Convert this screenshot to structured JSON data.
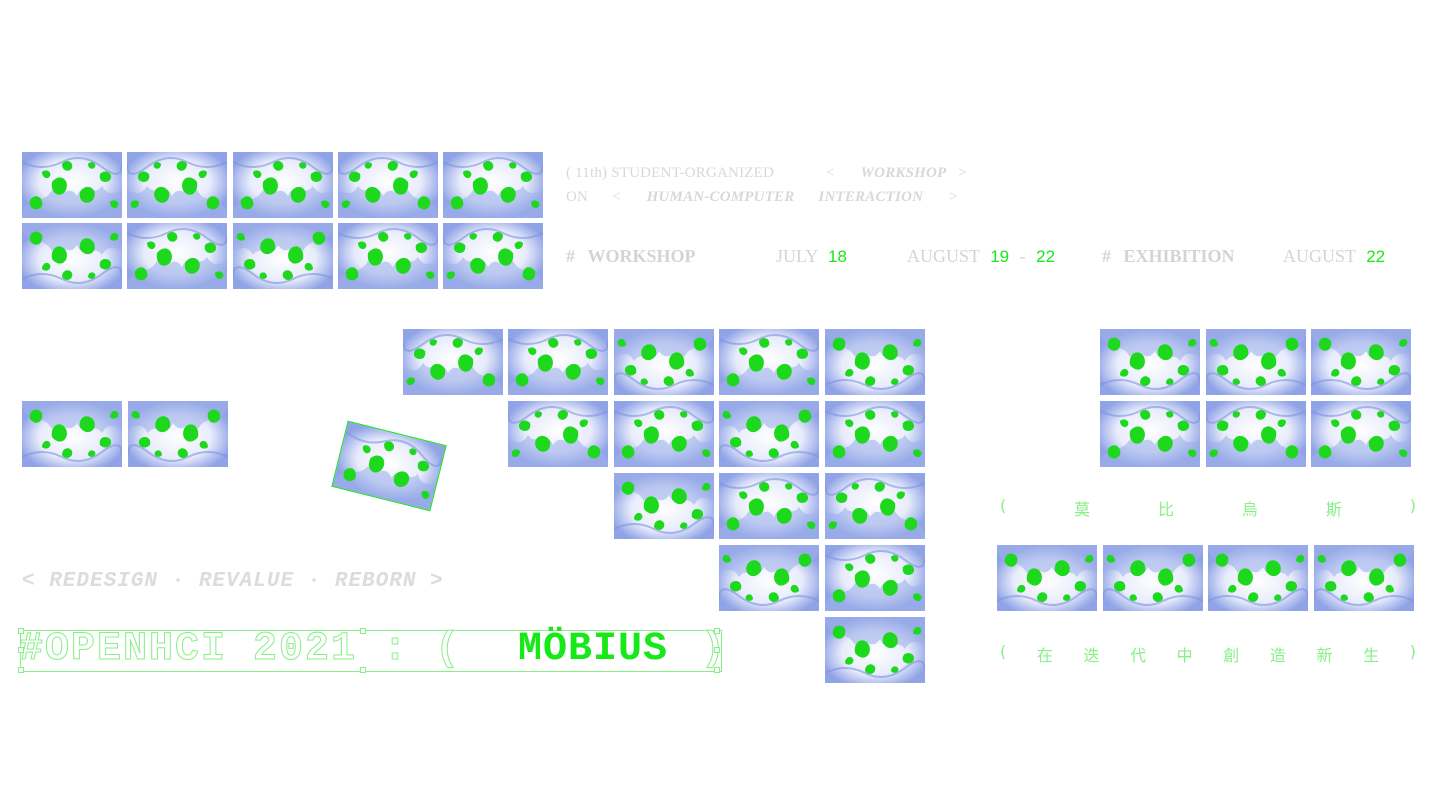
{
  "info": {
    "line1_prefix": "( 11th) STUDENT-ORGANIZED",
    "line1_lt": "<",
    "line1_word": "WORKSHOP",
    "line1_gt": ">",
    "line2_on": "ON",
    "line2_lt": "<",
    "line2_w1": "HUMAN-COMPUTER",
    "line2_w2": "INTERACTION",
    "line2_gt": ">"
  },
  "schedule": {
    "hash1": "#",
    "workshop_label": "WORKSHOP",
    "july_label": "JULY",
    "july_day": "18",
    "august_label": "AUGUST",
    "aug_start": "19",
    "dash": "-",
    "aug_end": "22",
    "hash2": "#",
    "exhibition_label": "EXHIBITION",
    "exh_month": "AUGUST",
    "exh_day": "22"
  },
  "slogan": "< REDESIGN · REVALUE · REBORN >",
  "title": {
    "hash_part": "#OPENHCI 2021 : (",
    "main": "MÖBIUS",
    "close": ")"
  },
  "cjk1": [
    "(",
    "莫",
    "比",
    "烏",
    "斯",
    ")"
  ],
  "cjk2": [
    "(",
    "在",
    "迭",
    "代",
    "中",
    "創",
    "造",
    "新",
    "生",
    ")"
  ],
  "colors": {
    "accent": "#17e817",
    "light_accent": "#86ef86",
    "gray_text": "#d4d4d4",
    "fractal_blue": "#8fa3e6"
  },
  "icons": [
    "fractal-image"
  ]
}
